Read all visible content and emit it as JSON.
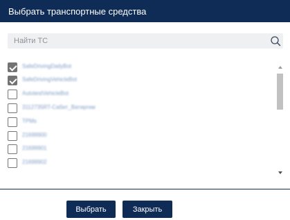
{
  "dialog": {
    "title": "Выбрать транспортные средства"
  },
  "search": {
    "placeholder": "Найти ТС",
    "value": "",
    "icon": "search-icon"
  },
  "vehicles": [
    {
      "label": "SafeDrivingDailyBot",
      "checked": true
    },
    {
      "label": "SafeDrivingVehicleBot",
      "checked": true
    },
    {
      "label": "AutotestVehicleBot",
      "checked": false
    },
    {
      "label": "3112735RT-Сабит_Ватиргем",
      "checked": false
    },
    {
      "label": "TPMs",
      "checked": false
    },
    {
      "label": "21699900",
      "checked": false
    },
    {
      "label": "21699901",
      "checked": false
    },
    {
      "label": "21699902",
      "checked": false
    }
  ],
  "footer": {
    "select_label": "Выбрать",
    "close_label": "Закрыть"
  },
  "colors": {
    "header": "#0f2c57",
    "button": "#0f2c57",
    "checked": "#737373"
  }
}
